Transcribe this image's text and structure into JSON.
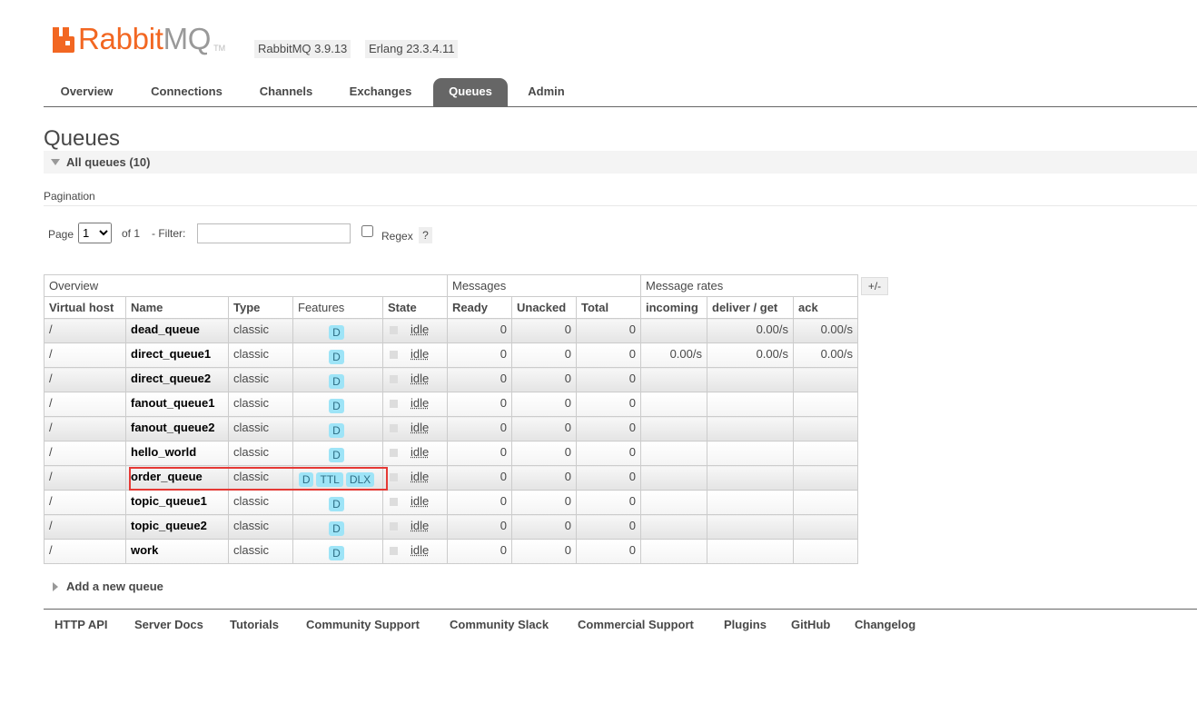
{
  "header": {
    "logo_text_rabbit": "Rabbit",
    "logo_text_mq": "MQ",
    "logo_tm": "TM",
    "version": "RabbitMQ 3.9.13",
    "erlang": "Erlang 23.3.4.11",
    "brand_color": "#f26722"
  },
  "tabs": [
    {
      "label": "Overview"
    },
    {
      "label": "Connections"
    },
    {
      "label": "Channels"
    },
    {
      "label": "Exchanges"
    },
    {
      "label": "Queues",
      "active": true
    },
    {
      "label": "Admin"
    }
  ],
  "page_title": "Queues",
  "section_label": "All queues (10)",
  "pagination": {
    "title": "Pagination",
    "page_label": "Page",
    "page_value": "1",
    "of_label": "of 1",
    "filter_label": "- Filter:",
    "filter_value": "",
    "regex_label": "Regex",
    "help": "?"
  },
  "table": {
    "groups": [
      "Overview",
      "Messages",
      "Message rates"
    ],
    "columns": [
      "Virtual host",
      "Name",
      "Type",
      "Features",
      "State",
      "Ready",
      "Unacked",
      "Total",
      "incoming",
      "deliver / get",
      "ack"
    ],
    "toggle": "+/-",
    "rows": [
      {
        "vhost": "/",
        "name": "dead_queue",
        "type": "classic",
        "features": [
          "D"
        ],
        "state": "idle",
        "ready": "0",
        "unacked": "0",
        "total": "0",
        "incoming": "",
        "deliver": "0.00/s",
        "ack": "0.00/s"
      },
      {
        "vhost": "/",
        "name": "direct_queue1",
        "type": "classic",
        "features": [
          "D"
        ],
        "state": "idle",
        "ready": "0",
        "unacked": "0",
        "total": "0",
        "incoming": "0.00/s",
        "deliver": "0.00/s",
        "ack": "0.00/s"
      },
      {
        "vhost": "/",
        "name": "direct_queue2",
        "type": "classic",
        "features": [
          "D"
        ],
        "state": "idle",
        "ready": "0",
        "unacked": "0",
        "total": "0",
        "incoming": "",
        "deliver": "",
        "ack": ""
      },
      {
        "vhost": "/",
        "name": "fanout_queue1",
        "type": "classic",
        "features": [
          "D"
        ],
        "state": "idle",
        "ready": "0",
        "unacked": "0",
        "total": "0",
        "incoming": "",
        "deliver": "",
        "ack": ""
      },
      {
        "vhost": "/",
        "name": "fanout_queue2",
        "type": "classic",
        "features": [
          "D"
        ],
        "state": "idle",
        "ready": "0",
        "unacked": "0",
        "total": "0",
        "incoming": "",
        "deliver": "",
        "ack": ""
      },
      {
        "vhost": "/",
        "name": "hello_world",
        "type": "classic",
        "features": [
          "D"
        ],
        "state": "idle",
        "ready": "0",
        "unacked": "0",
        "total": "0",
        "incoming": "",
        "deliver": "",
        "ack": ""
      },
      {
        "vhost": "/",
        "name": "order_queue",
        "type": "classic",
        "features": [
          "D",
          "TTL",
          "DLX"
        ],
        "state": "idle",
        "ready": "0",
        "unacked": "0",
        "total": "0",
        "incoming": "",
        "deliver": "",
        "ack": ""
      },
      {
        "vhost": "/",
        "name": "topic_queue1",
        "type": "classic",
        "features": [
          "D"
        ],
        "state": "idle",
        "ready": "0",
        "unacked": "0",
        "total": "0",
        "incoming": "",
        "deliver": "",
        "ack": ""
      },
      {
        "vhost": "/",
        "name": "topic_queue2",
        "type": "classic",
        "features": [
          "D"
        ],
        "state": "idle",
        "ready": "0",
        "unacked": "0",
        "total": "0",
        "incoming": "",
        "deliver": "",
        "ack": ""
      },
      {
        "vhost": "/",
        "name": "work",
        "type": "classic",
        "features": [
          "D"
        ],
        "state": "idle",
        "ready": "0",
        "unacked": "0",
        "total": "0",
        "incoming": "",
        "deliver": "",
        "ack": ""
      }
    ]
  },
  "add_queue_label": "Add a new queue",
  "footer_links": [
    "HTTP API",
    "Server Docs",
    "Tutorials",
    "Community Support",
    "Community Slack",
    "Commercial Support",
    "Plugins",
    "GitHub",
    "Changelog"
  ],
  "highlight_color": "#e53935"
}
